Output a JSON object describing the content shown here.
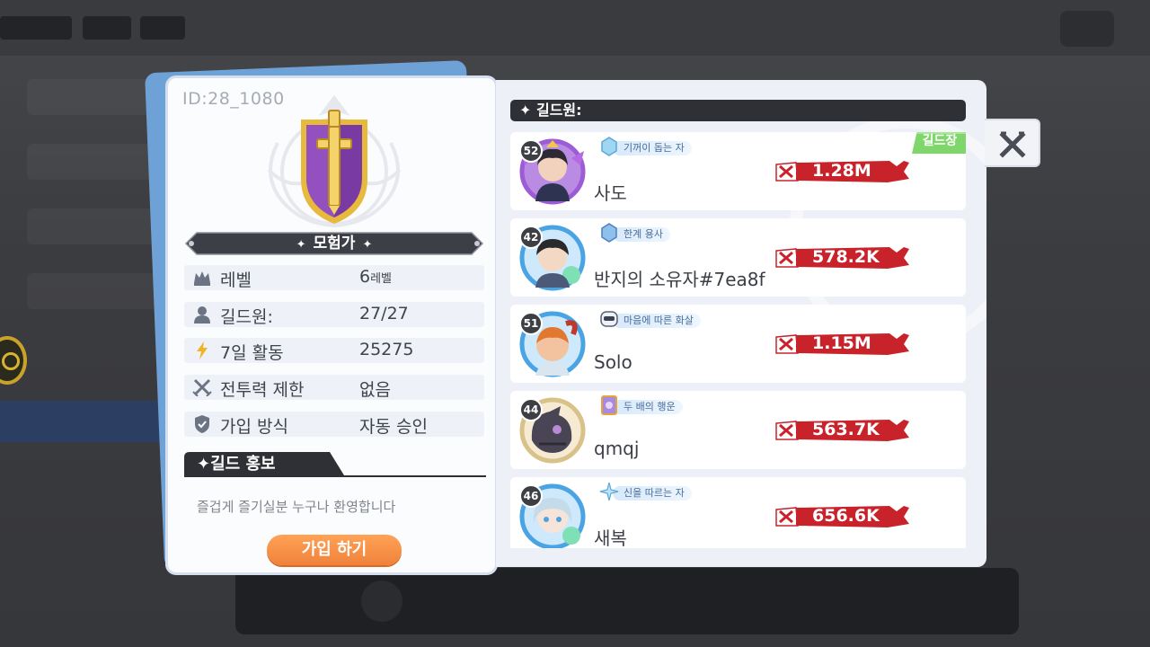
{
  "guild": {
    "id": "ID:28_1080",
    "name": "모험가",
    "info": [
      {
        "icon": "crown-icon",
        "label": "레벨",
        "value": "6",
        "suffix": "레벨"
      },
      {
        "icon": "person-icon",
        "label": "길드원:",
        "value": "27/27",
        "suffix": ""
      },
      {
        "icon": "lightning-icon",
        "label": "7일 활동",
        "value": "25275",
        "suffix": ""
      },
      {
        "icon": "crossed-swords-icon",
        "label": "전투력 제한",
        "value": "없음",
        "suffix": ""
      },
      {
        "icon": "shield-check-icon",
        "label": "가입 방식",
        "value": "자동 승인",
        "suffix": ""
      }
    ],
    "promo_title": "길드 홍보",
    "promo_text": "즐겁게 즐기실분 누구나 환영합니다",
    "join_label": "가입 하기"
  },
  "members_header": "길드원:",
  "members": [
    {
      "level": "52",
      "title": "기꺼이 돕는 자",
      "name": "사도",
      "power": "1.28M",
      "badge": "길드장",
      "ring": "#9b5cd6"
    },
    {
      "level": "42",
      "title": "한계 용사",
      "name": "반지의 소유자#7ea8f",
      "power": "578.2K",
      "badge": "",
      "ring": "#4aa3e3"
    },
    {
      "level": "51",
      "title": "마음에 따른 화살",
      "name": "Solo",
      "power": "1.15M",
      "badge": "",
      "ring": "#4aa3e3"
    },
    {
      "level": "44",
      "title": "두 배의 행운",
      "name": "qmqj",
      "power": "563.7K",
      "badge": "",
      "ring": "#d9c28a"
    },
    {
      "level": "46",
      "title": "신을 따르는 자",
      "name": "새복",
      "power": "656.6K",
      "badge": "",
      "ring": "#4aa3e3"
    }
  ],
  "colors": {
    "accent_orange": "#f0823b",
    "power_red": "#c8232b",
    "badge_green": "#7fd66b",
    "header_dark": "#2f3035"
  }
}
